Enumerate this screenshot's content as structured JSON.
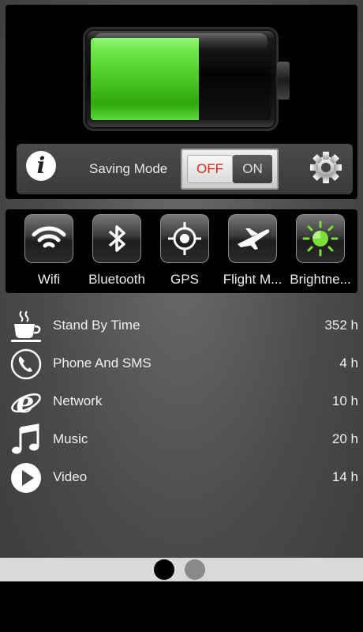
{
  "battery": {
    "level_fraction": 0.6,
    "fill_color": "#4fd12a"
  },
  "mode_bar": {
    "label": "Saving Mode",
    "toggle": {
      "off_label": "OFF",
      "on_label": "ON",
      "state": "off"
    }
  },
  "quick_toggles": [
    {
      "label": "Wifi",
      "icon": "wifi-icon"
    },
    {
      "label": "Bluetooth",
      "icon": "bluetooth-icon"
    },
    {
      "label": "GPS",
      "icon": "gps-icon"
    },
    {
      "label": "Flight M...",
      "icon": "airplane-icon"
    },
    {
      "label": "Brightne...",
      "icon": "brightness-icon",
      "accent": "#7be035"
    }
  ],
  "usage": [
    {
      "label": "Stand By Time",
      "value": "352 h",
      "icon": "coffee-cup-icon"
    },
    {
      "label": "Phone And SMS",
      "value": "4 h",
      "icon": "phone-icon"
    },
    {
      "label": "Network",
      "value": "10 h",
      "icon": "internet-explorer-icon"
    },
    {
      "label": "Music",
      "value": "20 h",
      "icon": "music-note-icon"
    },
    {
      "label": "Video",
      "value": "14 h",
      "icon": "play-icon"
    }
  ],
  "pager": {
    "pages": 2,
    "current": 1
  }
}
